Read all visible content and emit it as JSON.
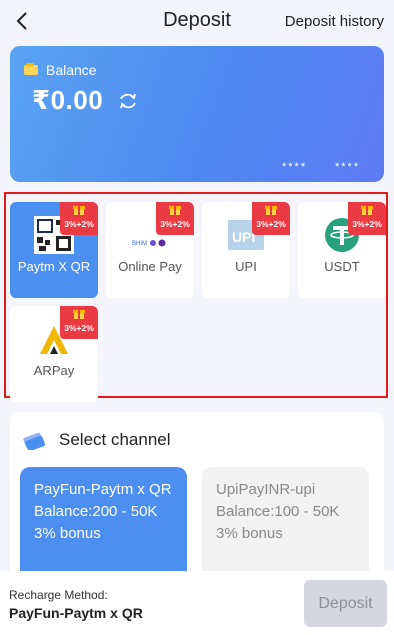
{
  "header": {
    "title": "Deposit",
    "history_label": "Deposit history"
  },
  "balance": {
    "label": "Balance",
    "amount": "₹0.00",
    "masked_1": "****",
    "masked_2": "****"
  },
  "methods": [
    {
      "label": "Paytm X QR",
      "bonus": "3%+2%",
      "active": true
    },
    {
      "label": "Online Pay",
      "bonus": "3%+2%",
      "active": false
    },
    {
      "label": "UPI",
      "bonus": "3%+2%",
      "active": false
    },
    {
      "label": "USDT",
      "bonus": "3%+2%",
      "active": false
    },
    {
      "label": "ARPay",
      "bonus": "3%+2%",
      "active": false
    }
  ],
  "channel": {
    "title": "Select channel",
    "options": [
      {
        "name": "PayFun-Paytm x QR",
        "balance": "Balance:200 - 50K",
        "bonus": "3% bonus",
        "active": true
      },
      {
        "name": "UpiPayINR-upi",
        "balance": "Balance:100 - 50K",
        "bonus": "3% bonus",
        "active": false
      }
    ]
  },
  "footer": {
    "method_label": "Recharge Method:",
    "method_value": "PayFun-Paytm x QR",
    "deposit_label": "Deposit"
  },
  "colors": {
    "accent": "#4b8ff0",
    "tag": "#ea3a44",
    "highlight_border": "#e21b1b"
  }
}
